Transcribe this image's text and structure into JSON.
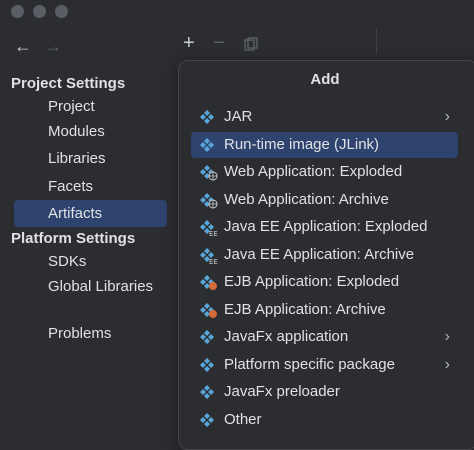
{
  "window": {
    "traffic_lights": [
      "close",
      "minimize",
      "zoom"
    ]
  },
  "nav": {
    "back_icon": "arrow-left-icon",
    "forward_icon": "arrow-right-icon"
  },
  "sidebar": {
    "project_settings": "Project Settings",
    "project_items": [
      {
        "label": "Project"
      },
      {
        "label": "Modules"
      },
      {
        "label": "Libraries"
      },
      {
        "label": "Facets"
      },
      {
        "label": "Artifacts",
        "selected": true
      }
    ],
    "platform_settings": "Platform Settings",
    "platform_items": [
      {
        "label": "SDKs"
      },
      {
        "label": "Global Libraries"
      }
    ],
    "problems": "Problems"
  },
  "toolbar": {
    "add_icon": "plus-icon",
    "remove_icon": "minus-icon",
    "copy_icon": "copy-icon"
  },
  "popup": {
    "title": "Add",
    "items": [
      {
        "label": "JAR",
        "icon": "diamond",
        "submenu": true
      },
      {
        "label": "Run-time image (JLink)",
        "icon": "diamond",
        "selected": true
      },
      {
        "label": "Web Application: Exploded",
        "icon": "web"
      },
      {
        "label": "Web Application: Archive",
        "icon": "web"
      },
      {
        "label": "Java EE Application: Exploded",
        "icon": "ee"
      },
      {
        "label": "Java EE Application: Archive",
        "icon": "ee"
      },
      {
        "label": "EJB Application: Exploded",
        "icon": "ejb"
      },
      {
        "label": "EJB Application: Archive",
        "icon": "ejb"
      },
      {
        "label": "JavaFx application",
        "icon": "diamond",
        "submenu": true
      },
      {
        "label": "Platform specific package",
        "icon": "diamond",
        "submenu": true
      },
      {
        "label": "JavaFx preloader",
        "icon": "diamond"
      },
      {
        "label": "Other",
        "icon": "diamond"
      }
    ]
  },
  "colors": {
    "accent": "#2e436e",
    "diamond": "#59a6d8",
    "ejb": "#d56b38"
  }
}
